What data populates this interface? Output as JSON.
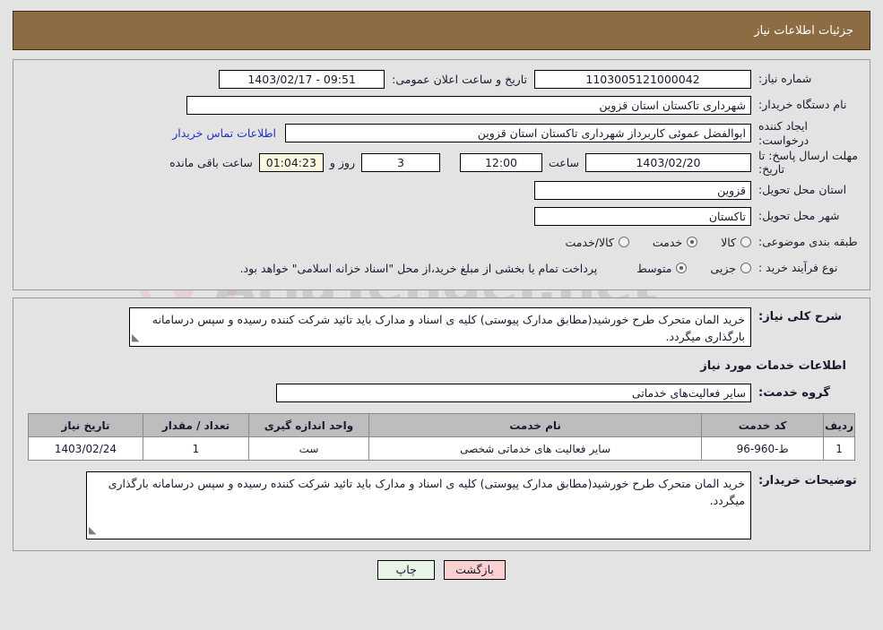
{
  "header": {
    "title": "جزئیات اطلاعات نیاز"
  },
  "watermark": {
    "text": "AriaTender.net",
    "shield_icon": "shield-icon"
  },
  "top_form": {
    "need_number": {
      "label": "شماره نیاز:",
      "value": "1103005121000042"
    },
    "public_announce": {
      "label": "تاریخ و ساعت اعلان عمومی:",
      "value": "09:51 - 1403/02/17"
    },
    "buyer_org": {
      "label": "نام دستگاه خریدار:",
      "value": "شهرداری تاکستان استان قزوین"
    },
    "request_creator": {
      "label": "ایجاد کننده درخواست:",
      "value": "ابوالفضل عموئی کاربرداز شهرداری تاکستان استان قزوین"
    },
    "buyer_contact_link": "اطلاعات تماس خریدار",
    "deadline": {
      "label": "مهلت ارسال پاسخ: تا تاریخ:",
      "date": "1403/02/20",
      "time_label": "ساعت",
      "time": "12:00",
      "days": "3",
      "days_label": "روز و",
      "countdown": "01:04:23",
      "countdown_suffix": "ساعت باقی مانده"
    },
    "delivery_province": {
      "label": "استان محل تحویل:",
      "value": "قزوین"
    },
    "delivery_city": {
      "label": "شهر محل تحویل:",
      "value": "تاکستان"
    },
    "category": {
      "label": "طبقه بندی موضوعی:",
      "options": [
        {
          "label": "کالا",
          "selected": false
        },
        {
          "label": "خدمت",
          "selected": true
        },
        {
          "label": "کالا/خدمت",
          "selected": false
        }
      ]
    },
    "purchase_process": {
      "label": "نوع فرآیند خرید :",
      "options": [
        {
          "label": "جزیی",
          "selected": false
        },
        {
          "label": "متوسط",
          "selected": true
        }
      ],
      "payment_note": "پرداخت تمام یا بخشی از مبلغ خرید،از محل \"اسناد خزانه اسلامی\" خواهد بود."
    }
  },
  "mid_section": {
    "need_description": {
      "label": "شرح کلی نیاز:",
      "value": "خرید المان متحرک طرح خورشید(مطابق مدارک پیوستی) کلیه ی اسناد و مدارک باید تائید شرکت کننده رسیده و سپس درسامانه بارگذاری میگردد."
    },
    "services_title": "اطلاعات خدمات مورد نیاز",
    "service_group": {
      "label": "گروه خدمت:",
      "value": "سایر فعالیت‌های خدماتی"
    },
    "table": {
      "headers": [
        "ردیف",
        "کد خدمت",
        "نام خدمت",
        "واحد اندازه گیری",
        "تعداد / مقدار",
        "تاریخ نیاز"
      ],
      "rows": [
        {
          "radif": "1",
          "code": "ط-960-96",
          "name": "سایر فعالیت های خدماتی شخصی",
          "unit": "ست",
          "qty": "1",
          "need_date": "1403/02/24"
        }
      ]
    },
    "buyer_notes": {
      "label": "توضیحات خریدار:",
      "value": "خرید المان متحرک طرح خورشید(مطابق مدارک پیوستی) کلیه ی اسناد و مدارک باید تائید شرکت کننده رسیده و سپس درسامانه بارگذاری میگردد."
    }
  },
  "footer": {
    "back_button": "بازگشت",
    "print_button": "چاپ"
  },
  "colors": {
    "header_bg": "#8d6b43",
    "countdown_bg": "#fbf8dd",
    "link": "#2331c8",
    "back_button_bg": "#fbd0d0",
    "print_button_bg": "#e6f5e6",
    "table_header_bg": "#bdbdbd"
  }
}
